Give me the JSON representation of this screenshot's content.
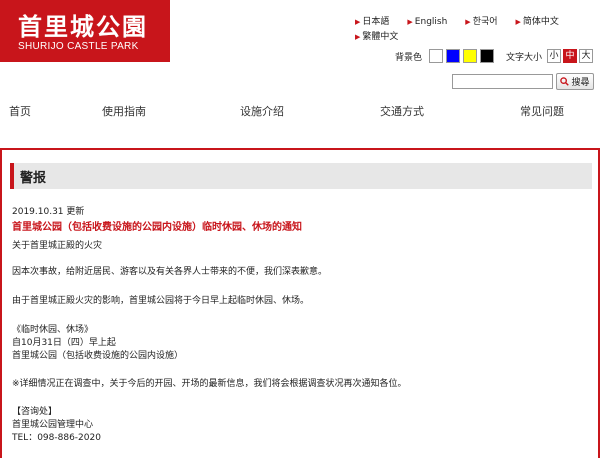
{
  "logo": {
    "title_jp": "首里城公園",
    "title_en": "SHURIJO CASTLE PARK"
  },
  "languages": [
    "日本語",
    "English",
    "한국어",
    "简体中文",
    "繁體中文"
  ],
  "accessibility": {
    "bg_label": "背景色",
    "bg_colors": [
      "#ffffff",
      "#0000ff",
      "#ffff00",
      "#000000"
    ],
    "size_label": "文字大小",
    "sizes": [
      "小",
      "中",
      "大"
    ],
    "active_size": "中"
  },
  "search": {
    "value": "",
    "button_label": "搜尋"
  },
  "nav": [
    "首页",
    "使用指南",
    "设施介绍",
    "交通方式",
    "常见问题"
  ],
  "notice": {
    "heading": "警报",
    "date": "2019.10.31 更新",
    "title": "首里城公园（包括收费设施的公园内设施）临时休园、休场的通知",
    "subtitle": "关于首里城正殿的火灾",
    "para1": "因本次事故，给附近居民、游客以及有关各界人士带来的不便，我们深表歉意。",
    "para2": "由于首里城正殿火灾的影响，首里城公园将于今日早上起临时休园、休场。",
    "closure_head": "《临时休园、休场》",
    "closure_date": "自10月31日（四）早上起",
    "closure_scope": "首里城公园（包括收费设施的公园内设施）",
    "para3": "※详细情况正在调查中，关于今后的开园、开场的最新信息，我们将会根据调查状况再次通知各位。",
    "contact_head": "【咨询处】",
    "contact_org": "首里城公园管理中心",
    "contact_tel": "TEL：098-886-2020"
  },
  "colors": {
    "brand_red": "#c8151b",
    "title_bg": "#e7e7e7"
  }
}
